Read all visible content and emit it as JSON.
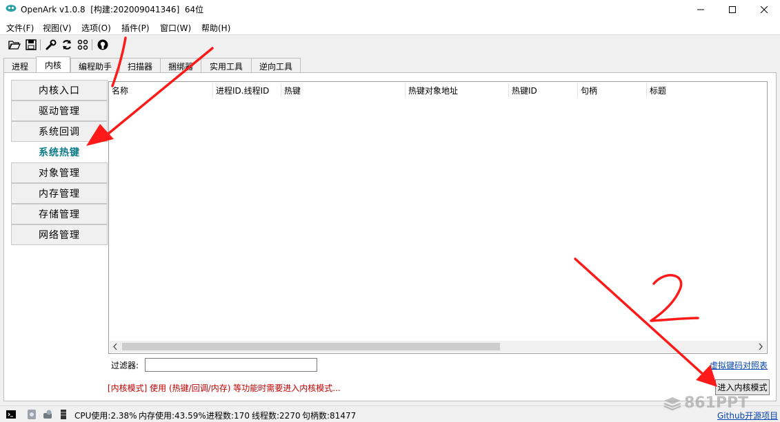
{
  "window": {
    "title": "OpenArk v1.0.8  [构建:202009041346]  64位"
  },
  "menu": [
    "文件(F)",
    "视图(V)",
    "选项(O)",
    "插件(P)",
    "窗口(W)",
    "帮助(H)"
  ],
  "toolbar": [
    "open-folder-icon",
    "save-icon",
    "wrench-icon",
    "refresh-icon",
    "apps-grid-icon",
    "github-icon"
  ],
  "tabs": [
    "进程",
    "内核",
    "编程助手",
    "扫描器",
    "捆绑器",
    "实用工具",
    "逆向工具"
  ],
  "active_tab": "内核",
  "sidebar": [
    "内核入口",
    "驱动管理",
    "系统回调",
    "系统热键",
    "对象管理",
    "内存管理",
    "存储管理",
    "网络管理"
  ],
  "selected_sidebar": "系统热键",
  "table": {
    "columns": [
      "名称",
      "进程ID.线程ID",
      "热键",
      "热键对象地址",
      "热键ID",
      "句柄",
      "标题"
    ],
    "rows": []
  },
  "filter": {
    "label": "过滤器:",
    "value": ""
  },
  "vk_link": "虚拟键码对照表",
  "notice": "[内核模式] 使用 (热键/回调/内存) 等功能时需要进入内核模式...",
  "enter_button": "进入内核模式",
  "status": {
    "cpu": "CPU使用:2.38%",
    "mem": "内存使用:43.59%",
    "proc": "进程数:170",
    "thread": "线程数:2270",
    "handle": "句柄数:81477"
  },
  "github_link": "Github开源项目",
  "annotations": [
    "1",
    "2"
  ],
  "watermark": "861PPT",
  "colors": {
    "selected_text": "#0a7a86",
    "notice_text": "#c00000",
    "annotation": "#ff1a1a",
    "link": "#0645ad"
  }
}
